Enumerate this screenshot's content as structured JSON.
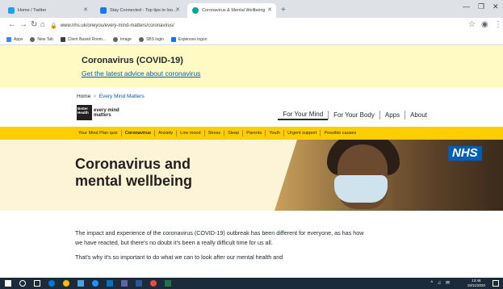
{
  "browser": {
    "tabs": [
      {
        "title": "Home / Twitter",
        "favicon_color": "#1da1f2",
        "active": false
      },
      {
        "title": "Stay Connected - Top tips to loo…",
        "favicon_color": "#1877f2",
        "active": false
      },
      {
        "title": "Coronavirus & Mental Wellbeing",
        "favicon_color": "#00a499",
        "active": true
      }
    ],
    "new_tab_label": "+",
    "url": "www.nhs.uk/oneyou/every-mind-matters/coronavirus/",
    "bookmarks": [
      {
        "label": "Apps",
        "color": "#4285f4"
      },
      {
        "label": "New Tab",
        "color": "#5f6368"
      },
      {
        "label": "Client Based Room...",
        "color": "#3c4043"
      },
      {
        "label": "Image",
        "color": "#5f6368"
      },
      {
        "label": "SBS login",
        "color": "#5f6368"
      },
      {
        "label": "Expenses logon",
        "color": "#1a73e8"
      }
    ]
  },
  "banner": {
    "title": "Coronavirus (COVID-19)",
    "link": "Get the latest advice about coronavirus",
    "bg_color": "#fff9c4"
  },
  "breadcrumb": {
    "home": "Home",
    "current": "Every Mind Matters"
  },
  "logo": {
    "box_line1": "Better",
    "box_line2": "Health",
    "text_line1": "every mind",
    "text_line2": "matters"
  },
  "main_nav": [
    "For Your Mind",
    "For Your Body",
    "Apps",
    "About"
  ],
  "sub_nav": {
    "items": [
      "Your Mind Plan quiz",
      "Coronavirus",
      "Anxiety",
      "Low mood",
      "Stress",
      "Sleep",
      "Parents",
      "Youth",
      "Urgent support",
      "Possible causes"
    ],
    "active": "Coronavirus",
    "bg_color": "#ffcd00"
  },
  "hero": {
    "title_line1": "Coronavirus and",
    "title_line2": "mental wellbeing",
    "nhs_logo": "NHS"
  },
  "body": {
    "paragraph1": "The impact and experience of the coronavirus (COVID-19) outbreak has been different for everyone, as has how we have reacted, but there's no doubt it's been a really difficult time for us all.",
    "paragraph2": "That's why it's so important to do what we can to look after our mental health and"
  },
  "taskbar": {
    "time": "13:46",
    "date": "19/11/2020"
  }
}
